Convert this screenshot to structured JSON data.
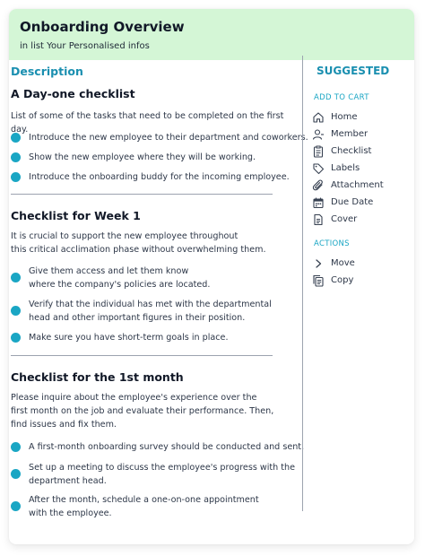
{
  "header": {
    "title": "Onboarding Overview",
    "subtitle": "in list Your Personalised infos"
  },
  "description": {
    "heading": "Description",
    "sections": [
      {
        "title": "A Day-one checklist",
        "intro": "List of some of the tasks that need to be completed on the first day.",
        "items": [
          "Introduce the new employee to their department and coworkers.",
          "Show the new employee where they will be working.",
          "Introduce the onboarding buddy for the incoming employee."
        ]
      },
      {
        "title": "Checklist for Week 1",
        "intro": "It is crucial to support the new employee throughout\nthis critical acclimation phase without overwhelming them.",
        "items": [
          "Give them access and let them know\nwhere the company's policies are located.",
          "Verify that the individual has met with the departmental\nhead and other important figures in their position.",
          "Make sure you have short-term goals in place."
        ]
      },
      {
        "title": "Checklist for the 1st month",
        "intro": "Please inquire about the employee's experience over the\nfirst month on the job and evaluate their performance. Then,\nfind issues and fix them.",
        "items": [
          "A first-month onboarding survey should be conducted and sent.",
          "Set up a meeting to discuss the employee's progress with the\ndepartment head.",
          "After the month, schedule a one-on-one appointment\nwith the employee."
        ]
      }
    ]
  },
  "sidebar": {
    "heading": "SUGGESTED",
    "add_to_cart": {
      "title": "ADD TO CART",
      "items": [
        {
          "label": "Home",
          "icon": "home-icon"
        },
        {
          "label": "Member",
          "icon": "member-icon"
        },
        {
          "label": "Checklist",
          "icon": "checklist-icon"
        },
        {
          "label": "Labels",
          "icon": "label-icon"
        },
        {
          "label": "Attachment",
          "icon": "paperclip-icon"
        },
        {
          "label": "Due Date",
          "icon": "calendar-icon"
        },
        {
          "label": "Cover",
          "icon": "cover-icon"
        }
      ]
    },
    "actions": {
      "title": "ACTIONS",
      "items": [
        {
          "label": "Move",
          "icon": "chevron-right-icon"
        },
        {
          "label": "Copy",
          "icon": "copy-icon"
        }
      ]
    }
  },
  "colors": {
    "header_bg": "#d4f6d6",
    "accent": "#1a8fb0",
    "bullet": "#1aa6c4"
  }
}
